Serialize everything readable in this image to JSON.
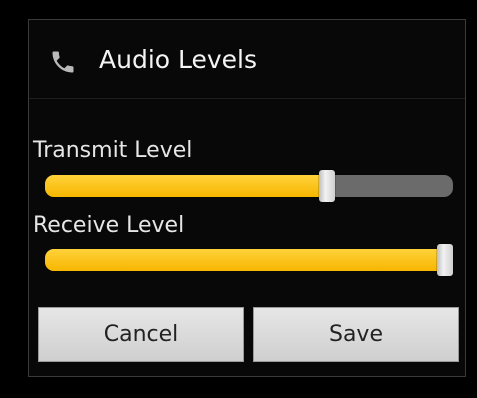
{
  "dialog": {
    "title": "Audio Levels",
    "title_icon": "phone-icon"
  },
  "sliders": [
    {
      "label": "Transmit Level",
      "value": 0.69
    },
    {
      "label": "Receive Level",
      "value": 1.0
    }
  ],
  "buttons": {
    "cancel_label": "Cancel",
    "save_label": "Save"
  },
  "colors": {
    "accent": "#f7b600",
    "track": "#6b6b6b"
  }
}
